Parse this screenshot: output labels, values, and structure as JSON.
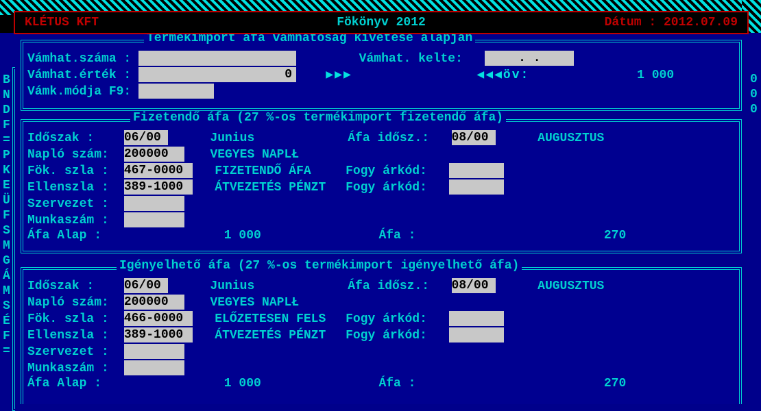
{
  "header": {
    "company": "KLÉTUS KFT",
    "title": "Fökönyv 2012",
    "date_label": "Dátum : 2012.07.09"
  },
  "sidebar": {
    "chars": [
      "B",
      "N",
      "D",
      "F",
      "=",
      "P",
      "K",
      "E",
      "Ü",
      "F",
      "S",
      "M",
      "G",
      "Á",
      "M",
      "S",
      "É",
      "F",
      "="
    ]
  },
  "top_panel": {
    "title": "Termékimport áfa vámhatóság kivetése alapján",
    "vamhat_szama_label": "Vámhat.száma :",
    "vamhat_szama_value": "",
    "vamhat_kelte_label": "Vámhat. kelte:",
    "vamhat_kelte_value": "   .  .  ",
    "vamhat_ertek_label": "Vámhat.érték :",
    "vamhat_ertek_value": "             0",
    "arrows_right": "▶▶▶",
    "arrows_left_ov": "◀◀◀öv:",
    "ov_value": "1 000",
    "vamk_mod_label": "Vámk.módja F9:",
    "vamk_mod_value": ""
  },
  "payable": {
    "title": "Fizetendő áfa (27 %-os termékimport fizetendő áfa)",
    "idoszak_label": "Időszak   :",
    "idoszak_value": "06/00",
    "idoszak_name": "Junius",
    "afa_idosz_label": "Áfa idősz.:",
    "afa_idosz_value": "08/00",
    "afa_idosz_name": "AUGUSZTUS",
    "naplo_label": "Napló szám:",
    "naplo_value": "200000",
    "naplo_name": "VEGYES NAPLŁ",
    "fok_label": "Fök. szla :",
    "fok_value": "467-0000",
    "fok_name": "FIZETENDŐ ÁFA",
    "fogy_arkod_label": "Fogy árkód:",
    "fogy_arkod_value": "",
    "ellen_label": "Ellenszla :",
    "ellen_value": "389-1000",
    "ellen_name": "ÁTVEZETÉS PÉNZT",
    "fogy_arkod2_label": "Fogy árkód:",
    "fogy_arkod2_value": "",
    "szervezet_label": "Szervezet :",
    "szervezet_value": "",
    "munkaszam_label": "Munkaszám :",
    "munkaszam_value": "",
    "afa_alap_label": "Áfa Alap  :",
    "afa_alap_value": "1 000",
    "afa_label": "Áfa       :",
    "afa_value": "270"
  },
  "claimable": {
    "title": "Igényelhető áfa (27 %-os termékimport igényelhető áfa)",
    "idoszak_label": "Időszak   :",
    "idoszak_value": "06/00",
    "idoszak_name": "Junius",
    "afa_idosz_label": "Áfa idősz.:",
    "afa_idosz_value": "08/00",
    "afa_idosz_name": "AUGUSZTUS",
    "naplo_label": "Napló szám:",
    "naplo_value": "200000",
    "naplo_name": "VEGYES NAPLŁ",
    "fok_label": "Fök. szla :",
    "fok_value": "466-0000",
    "fok_name": "ELŐZETESEN FELS",
    "fogy_arkod_label": "Fogy árkód:",
    "fogy_arkod_value": "",
    "ellen_label": "Ellenszla :",
    "ellen_value": "389-1000",
    "ellen_name": "ÁTVEZETÉS PÉNZT",
    "fogy_arkod2_label": "Fogy árkód:",
    "fogy_arkod2_value": "",
    "szervezet_label": "Szervezet :",
    "szervezet_value": "",
    "munkaszam_label": "Munkaszám :",
    "munkaszam_value": "",
    "afa_alap_label": "Áfa Alap  :",
    "afa_alap_value": "1 000",
    "afa_label": "Áfa       :",
    "afa_value": "270"
  },
  "right_zero_1": "0",
  "right_zero_2": "0",
  "right_zero_3": "0"
}
